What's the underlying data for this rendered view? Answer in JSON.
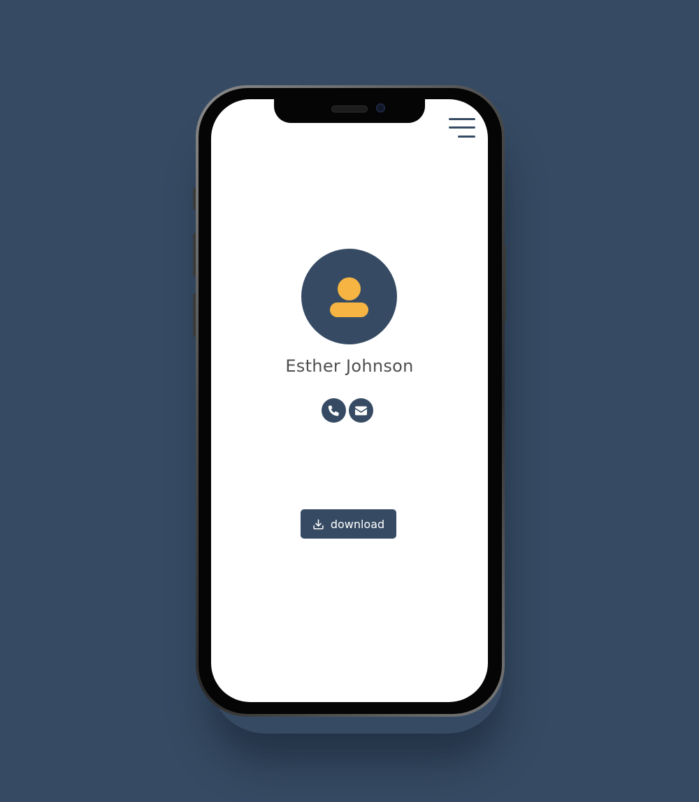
{
  "theme": {
    "background": "#364b63",
    "accent": "#364b63",
    "avatar_icon_color": "#f6b543",
    "screen_background": "#ffffff"
  },
  "header": {
    "menu_icon": "hamburger-menu-icon"
  },
  "profile": {
    "name": "Esther Johnson",
    "avatar_icon": "user-icon"
  },
  "contact_actions": [
    {
      "icon": "phone-icon"
    },
    {
      "icon": "envelope-icon"
    }
  ],
  "download": {
    "label": "download",
    "icon": "download-icon"
  }
}
